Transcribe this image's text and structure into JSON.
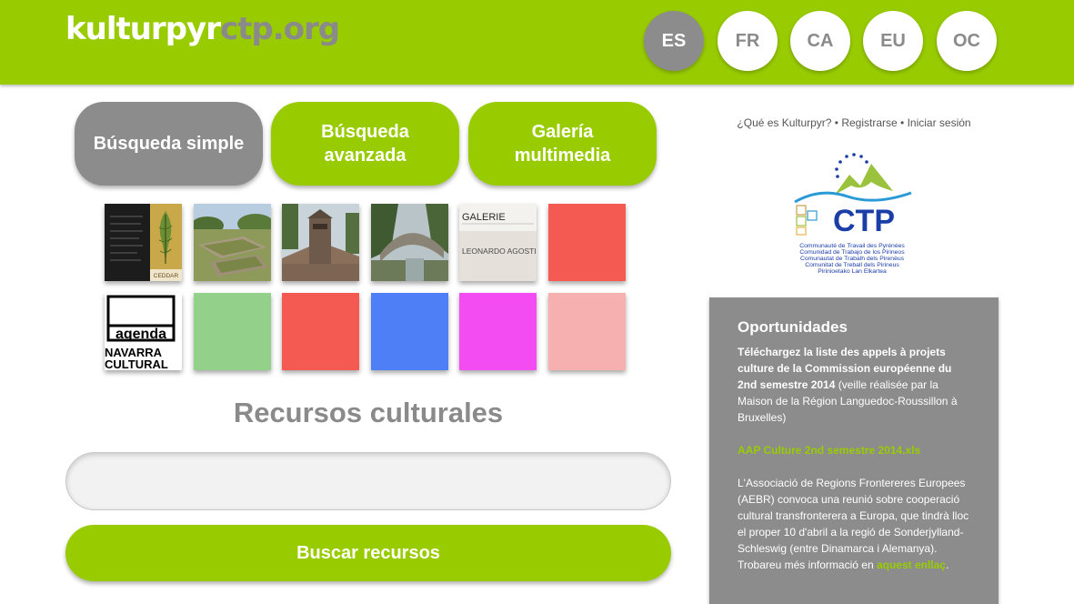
{
  "header": {
    "logo_part1": "kulturpyr",
    "logo_part2": "ctp.org",
    "languages": [
      {
        "code": "ES",
        "active": true
      },
      {
        "code": "FR",
        "active": false
      },
      {
        "code": "CA",
        "active": false
      },
      {
        "code": "EU",
        "active": false
      },
      {
        "code": "OC",
        "active": false
      }
    ]
  },
  "tabs": [
    {
      "label": "Búsqueda simple",
      "active": true
    },
    {
      "label": "Búsqueda avanzada",
      "active": false
    },
    {
      "label": "Galería multimedia",
      "active": false
    }
  ],
  "gallery": {
    "thumb_texts": {
      "ceddar": "CEDDAR",
      "galerie_1": "GALERIE",
      "galerie_2": "LEONARDO AGOSTI",
      "agenda_1": "agenda",
      "agenda_2": "NAVARRA",
      "agenda_3": "CULTURAL"
    },
    "row2_colors": [
      "#93d08a",
      "#f55a52",
      "#4f7ff7",
      "#f24cf2",
      "#f6b0b0"
    ],
    "row1_color": "#f55a52"
  },
  "main": {
    "section_title": "Recursos culturales",
    "search_value": "",
    "search_button": "Buscar recursos"
  },
  "sidebar": {
    "links": [
      "¿Qué es Kulturpyr?",
      "Registrarse",
      "Iniciar sesión"
    ],
    "separator": " • ",
    "ctp_logo": {
      "name": "CTP",
      "lines": [
        "Communauté de Travail des Pyrénées",
        "Comunidad de Trabajo de los Pirineos",
        "Comunautat de Trabalh dels Pirenèus",
        "Comunitat de Treball dels Pirineus",
        "Pirinioetako Lan Elkartea"
      ]
    },
    "opportunities": {
      "title": "Oportunidades",
      "p1_bold": "Téléchargez la liste des appels à projets culture de la Commission européenne du 2nd semestre 2014",
      "p1_rest": " (veille réalisée par la Maison de la Région Languedoc-Roussillon à Bruxelles)",
      "file_link": "AAP Culture 2nd semestre 2014.xls",
      "p3_text": "L'Associació de Regions Frontereres Europees (AEBR) convoca una reunió sobre cooperació cultural transfronterera a Europa, que tindrà lloc el proper 10 d'abril a la regió de Sonderjylland-Schleswig (entre Dinamarca i Alemanya). Trobareu més informació en ",
      "p3_link": "aquest enllaç",
      "p3_end": "."
    }
  },
  "colors": {
    "accent": "#99cc00",
    "grey": "#8c8c8c"
  }
}
